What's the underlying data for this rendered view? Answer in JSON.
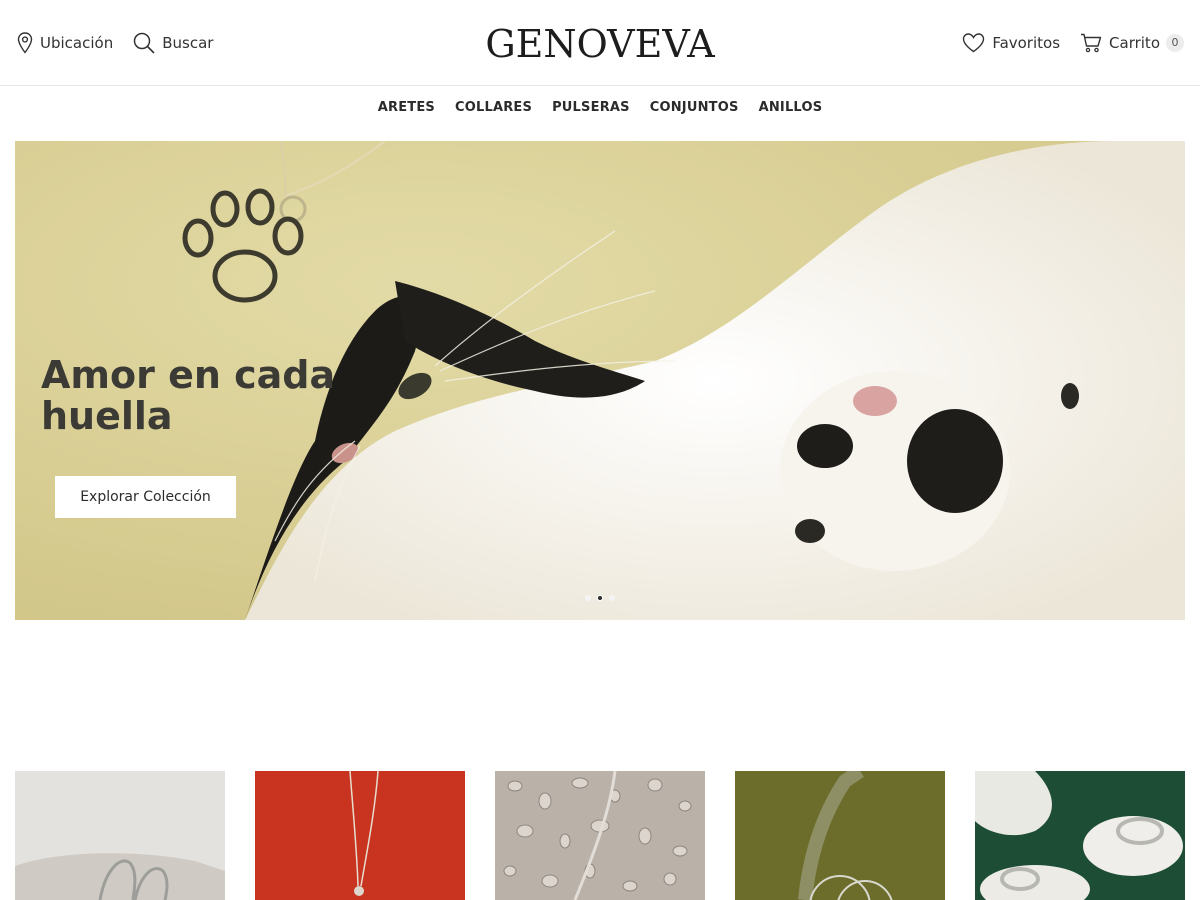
{
  "header": {
    "location_label": "Ubicación",
    "search_label": "Buscar",
    "logo": "GENOVEVA",
    "favorites_label": "Favoritos",
    "cart_label": "Carrito",
    "cart_count": "0"
  },
  "nav": {
    "items": [
      "ARETES",
      "COLLARES",
      "PULSERAS",
      "CONJUNTOS",
      "ANILLOS"
    ]
  },
  "hero": {
    "title": "Amor en cada huella",
    "button_label": "Explorar Colección",
    "slides_total": 3,
    "active_slide": 2
  },
  "tiles": {
    "count": 5
  },
  "colors": {
    "text": "#2b2b2b",
    "hero_bg": "#d9cf95",
    "tile_bg_1": "#e7e5e2",
    "tile_bg_2": "#c8331f",
    "tile_bg_3": "#bdb3aa",
    "tile_bg_4": "#6e6e2a",
    "tile_bg_5": "#1e4d36"
  }
}
